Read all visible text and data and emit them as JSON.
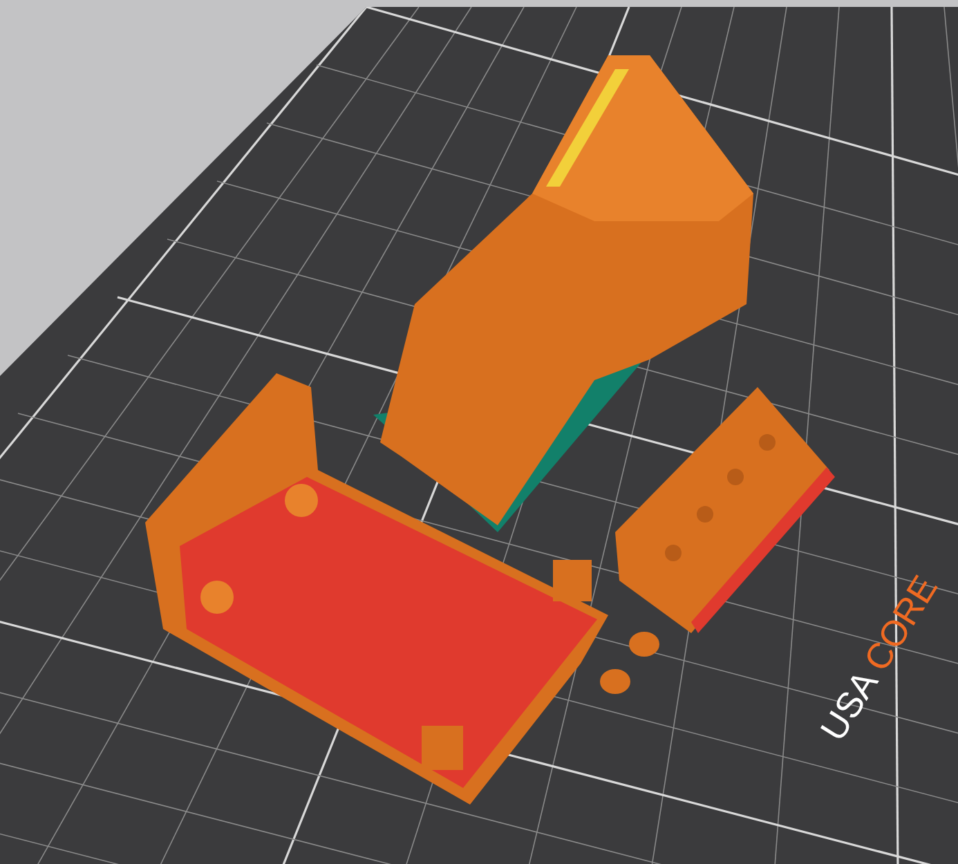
{
  "bed_label": {
    "prefix": "USA",
    "brand": "CORE"
  }
}
